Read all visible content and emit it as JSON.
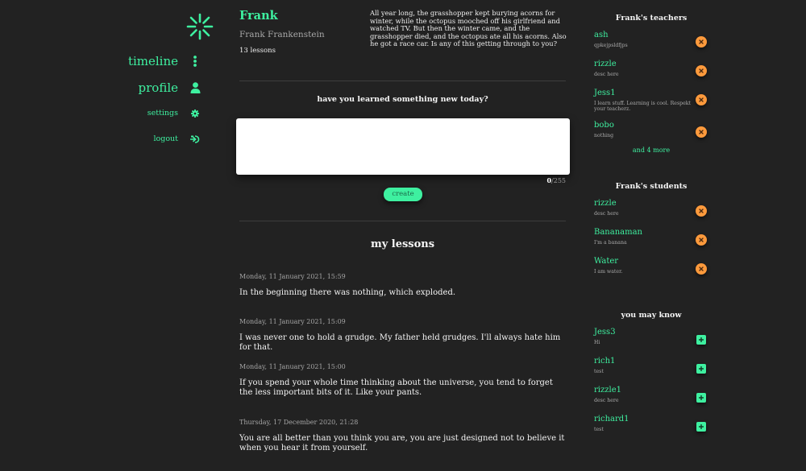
{
  "nav": {
    "items": [
      {
        "label": "timeline",
        "icon": "more-vertical-icon"
      },
      {
        "label": "profile",
        "icon": "user-icon"
      },
      {
        "label": "settings",
        "icon": "gear-icon"
      },
      {
        "label": "logout",
        "icon": "logout-icon"
      }
    ]
  },
  "profile": {
    "username": "Frank",
    "full_name": "Frank Frankenstein",
    "lessons_count": "13 lessons",
    "bio": "All year long, the grasshopper kept burying acorns for winter, while the octopus mooched off his girlfriend and watched TV. But then the winter came, and the grasshopper died, and the octopus ate all his acorns. Also he got a race car. Is any of this getting through to you?"
  },
  "composer": {
    "question": "have you learned something new today?",
    "value": "",
    "placeholder": "",
    "count": "0",
    "max": "/255",
    "create_label": "create"
  },
  "lessons": {
    "title": "my lessons",
    "items": [
      {
        "date": "Monday, 11 January 2021, 15:59",
        "text": "In the beginning there was nothing, which exploded."
      },
      {
        "date": "Monday, 11 January 2021, 15:09",
        "text": "I was never one to hold a grudge. My father held grudges. I'll always hate him for that."
      },
      {
        "date": "Monday, 11 January 2021, 15:00",
        "text": "If you spend your whole time thinking about the universe, you tend to forget the less important bits of it. Like your pants."
      },
      {
        "date": "Thursday, 17 December 2020, 21:28",
        "text": "You are all better than you think you are, you are just designed not to believe it when you hear it from yourself."
      }
    ]
  },
  "teachers": {
    "title": "Frank's teachers",
    "items": [
      {
        "name": "ash",
        "desc": "qpkejpsldfjps"
      },
      {
        "name": "rizzle",
        "desc": "desc here"
      },
      {
        "name": "Jess1",
        "desc": "I learn stuff. Learning is cool. Respekt your teacherz."
      },
      {
        "name": "bobo",
        "desc": "nothing"
      }
    ],
    "more_label": "and 4 more"
  },
  "students": {
    "title": "Frank's students",
    "items": [
      {
        "name": "rizzle",
        "desc": "desc here"
      },
      {
        "name": "Bananaman",
        "desc": "I'm a banana"
      },
      {
        "name": "Water",
        "desc": "I am water."
      }
    ]
  },
  "suggestions": {
    "title": "you may know",
    "items": [
      {
        "name": "Jess3",
        "desc": "Hi"
      },
      {
        "name": "rich1",
        "desc": "test"
      },
      {
        "name": "rizzle1",
        "desc": "desc here"
      },
      {
        "name": "richard1",
        "desc": "test"
      }
    ]
  },
  "colors": {
    "background": "#222222",
    "accent": "#3ef0a0",
    "remove": "#ff9a3c"
  }
}
